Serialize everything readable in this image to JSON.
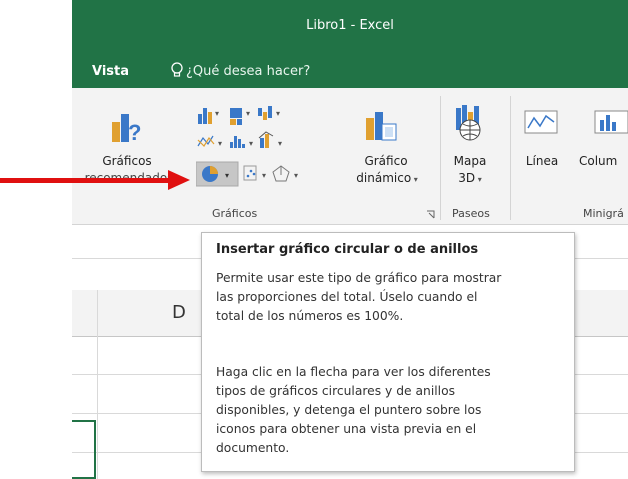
{
  "window": {
    "title": "Libro1 - Excel"
  },
  "tabs": {
    "view": "Vista",
    "tell_me": "¿Qué desea hacer?"
  },
  "ribbon": {
    "recommended_charts": {
      "line1": "Gráficos",
      "line2": "recomendados"
    },
    "pivot_chart": {
      "line1": "Gráfico",
      "line2": "dinámico"
    },
    "map3d": {
      "line1": "Mapa",
      "line2": "3D"
    },
    "sparkline_line": "Línea",
    "sparkline_column": "Colum",
    "group_charts": "Gráficos",
    "group_tours": "Paseos",
    "group_sparklines": "Minigrá"
  },
  "sheet": {
    "column_header_d": "D"
  },
  "tooltip": {
    "title": "Insertar gráfico circular o de anillos",
    "paragraph1": "Permite usar este tipo de gráfico para mostrar\nlas proporciones del total. Úselo cuando el\ntotal de los números es 100%.",
    "paragraph2": "Haga clic en la flecha para ver los diferentes\ntipos de gráficos circulares y de anillos\ndisponibles, y detenga el puntero sobre los\niconos para obtener una vista previa en el\ndocumento."
  },
  "colors": {
    "excel_green": "#217346",
    "arrow_red": "#e01010",
    "ribbon_bg": "#f3f3f3"
  }
}
